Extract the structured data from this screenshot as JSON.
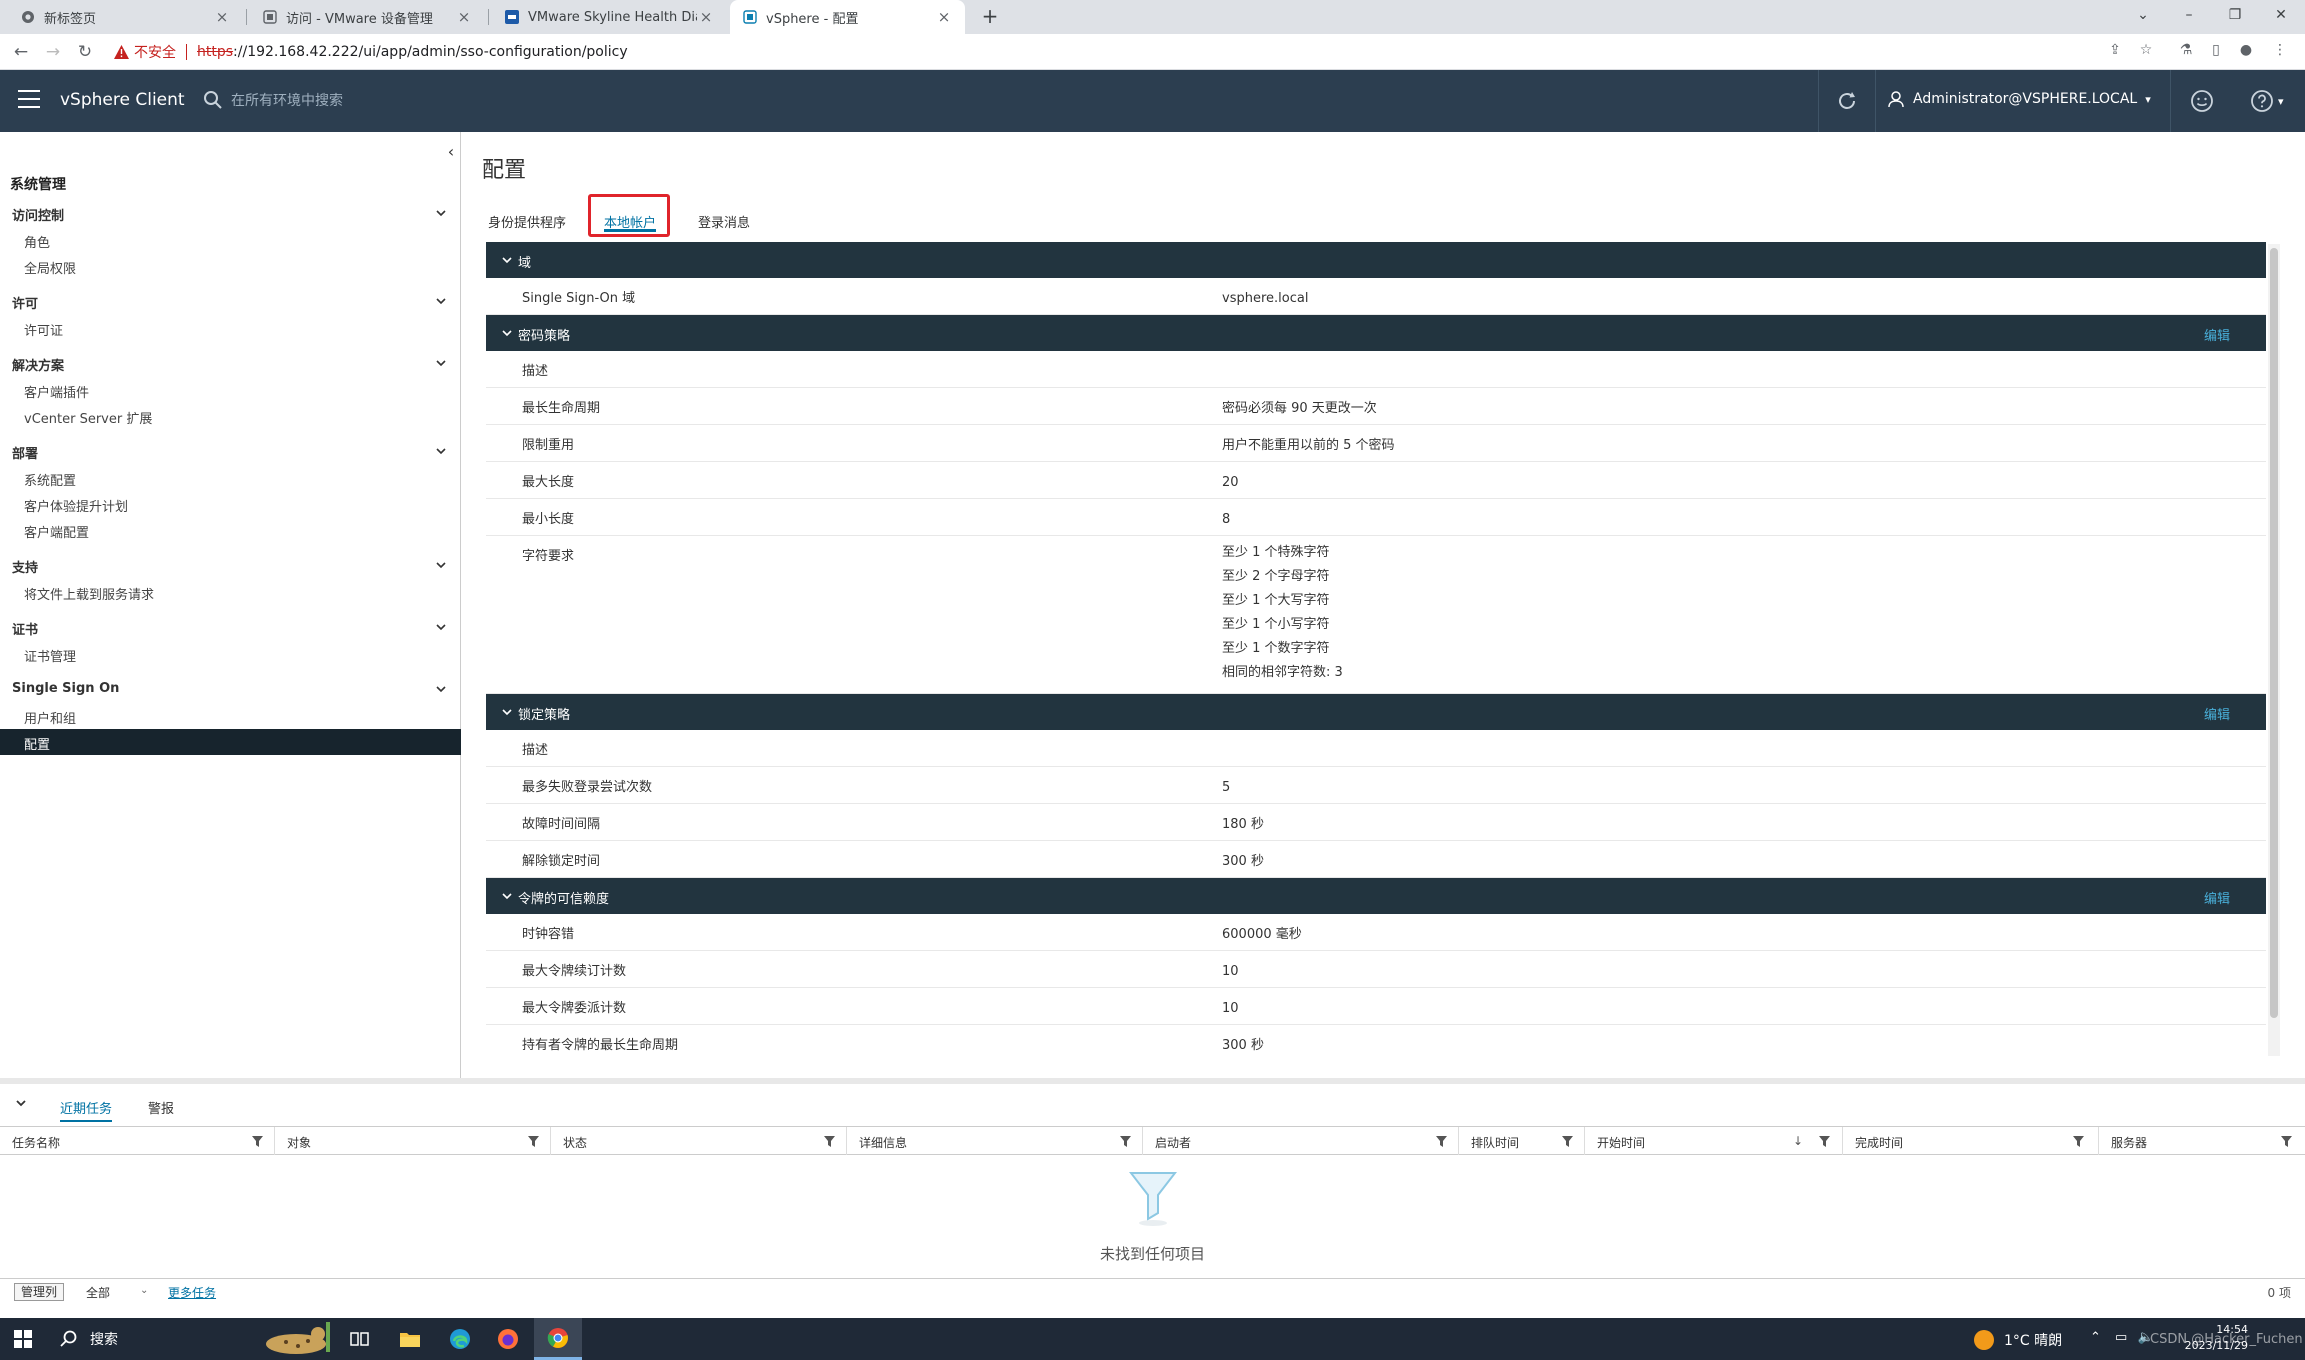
{
  "browser": {
    "tabs": [
      {
        "title": "新标签页",
        "icon": "chrome-icon"
      },
      {
        "title": "访问 - VMware 设备管理",
        "icon": "page-icon"
      },
      {
        "title": "VMware Skyline Health Diagnostics",
        "icon": "vmware-icon"
      },
      {
        "title": "vSphere - 配置",
        "icon": "vsphere-icon"
      }
    ],
    "active_tab": 3,
    "address": {
      "insecure_label": "不安全",
      "url_scheme": "https",
      "url_rest": "://192.168.42.222/ui/app/admin/sso-configuration/policy"
    }
  },
  "header": {
    "product": "vSphere Client",
    "search_placeholder": "在所有环境中搜索",
    "user": "Administrator@VSPHERE.LOCAL"
  },
  "sidebar": {
    "title": "系统管理",
    "groups": [
      {
        "label": "访问控制",
        "items": [
          "角色",
          "全局权限"
        ]
      },
      {
        "label": "许可",
        "items": [
          "许可证"
        ]
      },
      {
        "label": "解决方案",
        "items": [
          "客户端插件",
          "vCenter Server 扩展"
        ]
      },
      {
        "label": "部署",
        "items": [
          "系统配置",
          "客户体验提升计划",
          "客户端配置"
        ]
      },
      {
        "label": "支持",
        "items": [
          "将文件上载到服务请求"
        ]
      },
      {
        "label": "证书",
        "items": [
          "证书管理"
        ]
      },
      {
        "label": "Single Sign On",
        "items": [
          "用户和组",
          "配置"
        ]
      }
    ],
    "selected": "配置"
  },
  "main": {
    "title": "配置",
    "tabs": [
      "身份提供程序",
      "本地帐户",
      "登录消息"
    ],
    "active_tab": 1,
    "edit_label": "编辑",
    "sections": {
      "domain": {
        "title": "域",
        "rows": [
          {
            "label": "Single Sign-On 域",
            "value": "vsphere.local"
          }
        ]
      },
      "password": {
        "title": "密码策略",
        "rows": [
          {
            "label": "描述",
            "value": ""
          },
          {
            "label": "最长生命周期",
            "value": "密码必须每 90 天更改一次"
          },
          {
            "label": "限制重用",
            "value": "用户不能重用以前的 5 个密码"
          },
          {
            "label": "最大长度",
            "value": "20"
          },
          {
            "label": "最小长度",
            "value": "8"
          },
          {
            "label": "字符要求",
            "value": [
              "至少 1 个特殊字符",
              "至少 2 个字母字符",
              "至少 1 个大写字符",
              "至少 1 个小写字符",
              "至少 1 个数字字符",
              "相同的相邻字符数: 3"
            ]
          }
        ]
      },
      "lockout": {
        "title": "锁定策略",
        "rows": [
          {
            "label": "描述",
            "value": ""
          },
          {
            "label": "最多失败登录尝试次数",
            "value": "5"
          },
          {
            "label": "故障时间间隔",
            "value": "180 秒"
          },
          {
            "label": "解除锁定时间",
            "value": "300 秒"
          }
        ]
      },
      "token": {
        "title": "令牌的可信赖度",
        "rows": [
          {
            "label": "时钟容错",
            "value": "600000 毫秒"
          },
          {
            "label": "最大令牌续订计数",
            "value": "10"
          },
          {
            "label": "最大令牌委派计数",
            "value": "10"
          },
          {
            "label": "持有者令牌的最长生命周期",
            "value": "300 秒"
          }
        ]
      }
    }
  },
  "tasks": {
    "tabs": [
      "近期任务",
      "警报"
    ],
    "active_tab": 0,
    "columns": [
      "任务名称",
      "对象",
      "状态",
      "详细信息",
      "启动者",
      "排队时间",
      "开始时间",
      "完成时间",
      "服务器"
    ],
    "empty_text": "未找到任何项目",
    "manage_columns": "管理列",
    "filter": "全部",
    "more_tasks": "更多任务",
    "count": "0 项"
  },
  "taskbar": {
    "search": "搜索",
    "weather": "1°C 晴朗",
    "time": "14:54",
    "date": "2023/11/29",
    "watermark": "CSDN @Hacker_Fuchen"
  },
  "colors": {
    "header_bg": "#2c3e50",
    "section_head_bg": "#22343f",
    "accent": "#0072a3",
    "edit_link": "#49afd9",
    "highlight_box": "#e0242b"
  }
}
